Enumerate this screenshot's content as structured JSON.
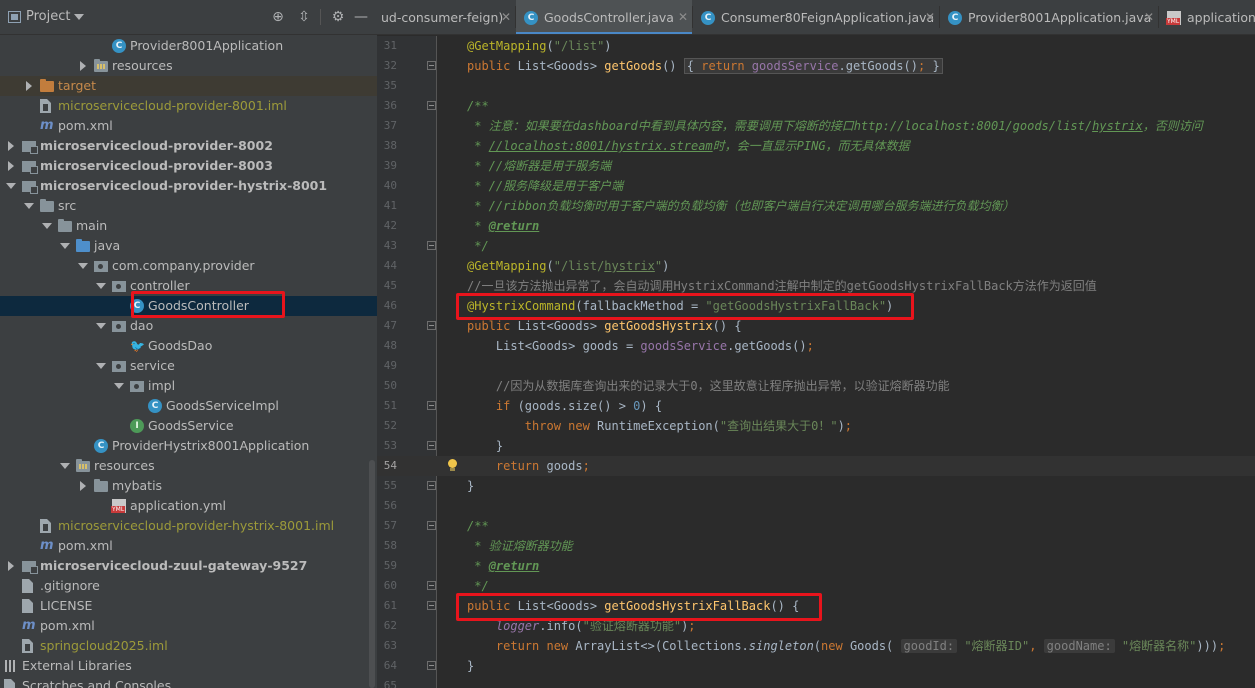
{
  "project": {
    "title": "Project"
  },
  "tree": [
    {
      "label": "Provider8001Application",
      "icon": "class-icon",
      "arrow": "",
      "bold": false,
      "color": ""
    },
    {
      "label": "resources",
      "icon": "resources-folder-icon",
      "arrow": "right",
      "bold": false,
      "color": ""
    },
    {
      "label": "target",
      "icon": "folder-orange-icon",
      "arrow": "right",
      "bold": false,
      "color": "orange"
    },
    {
      "label": "microservicecloud-provider-8001.iml",
      "icon": "iml-file-icon",
      "arrow": "",
      "bold": false,
      "color": "olive"
    },
    {
      "label": "pom.xml",
      "icon": "maven-icon",
      "arrow": "",
      "bold": false,
      "color": ""
    },
    {
      "label": "microservicecloud-provider-8002",
      "icon": "module-folder-icon",
      "arrow": "right",
      "bold": true,
      "color": ""
    },
    {
      "label": "microservicecloud-provider-8003",
      "icon": "module-folder-icon",
      "arrow": "right",
      "bold": true,
      "color": ""
    },
    {
      "label": "microservicecloud-provider-hystrix-8001",
      "icon": "module-folder-icon",
      "arrow": "down",
      "bold": true,
      "color": ""
    },
    {
      "label": "src",
      "icon": "folder-icon",
      "arrow": "down",
      "bold": false,
      "color": ""
    },
    {
      "label": "main",
      "icon": "folder-icon",
      "arrow": "down",
      "bold": false,
      "color": ""
    },
    {
      "label": "java",
      "icon": "folder-blue-icon",
      "arrow": "down",
      "bold": false,
      "color": ""
    },
    {
      "label": "com.company.provider",
      "icon": "package-icon",
      "arrow": "down",
      "bold": false,
      "color": ""
    },
    {
      "label": "controller",
      "icon": "package-icon",
      "arrow": "down",
      "bold": false,
      "color": ""
    },
    {
      "label": "GoodsController",
      "icon": "class-icon",
      "arrow": "",
      "bold": false,
      "color": ""
    },
    {
      "label": "dao",
      "icon": "package-icon",
      "arrow": "down",
      "bold": false,
      "color": ""
    },
    {
      "label": "GoodsDao",
      "icon": "mybatis-icon",
      "arrow": "",
      "bold": false,
      "color": ""
    },
    {
      "label": "service",
      "icon": "package-icon",
      "arrow": "down",
      "bold": false,
      "color": ""
    },
    {
      "label": "impl",
      "icon": "package-icon",
      "arrow": "down",
      "bold": false,
      "color": ""
    },
    {
      "label": "GoodsServiceImpl",
      "icon": "class-icon",
      "arrow": "",
      "bold": false,
      "color": ""
    },
    {
      "label": "GoodsService",
      "icon": "interface-icon",
      "arrow": "",
      "bold": false,
      "color": ""
    },
    {
      "label": "ProviderHystrix8001Application",
      "icon": "class-icon",
      "arrow": "",
      "bold": false,
      "color": ""
    },
    {
      "label": "resources",
      "icon": "resources-folder-icon",
      "arrow": "down",
      "bold": false,
      "color": ""
    },
    {
      "label": "mybatis",
      "icon": "folder-icon",
      "arrow": "right",
      "bold": false,
      "color": ""
    },
    {
      "label": "application.yml",
      "icon": "yml-file-icon",
      "arrow": "",
      "bold": false,
      "color": ""
    },
    {
      "label": "microservicecloud-provider-hystrix-8001.iml",
      "icon": "iml-file-icon",
      "arrow": "",
      "bold": false,
      "color": "olive"
    },
    {
      "label": "pom.xml",
      "icon": "maven-icon",
      "arrow": "",
      "bold": false,
      "color": ""
    },
    {
      "label": "microservicecloud-zuul-gateway-9527",
      "icon": "module-folder-icon",
      "arrow": "right",
      "bold": true,
      "color": ""
    },
    {
      "label": ".gitignore",
      "icon": "text-file-icon",
      "arrow": "",
      "bold": false,
      "color": ""
    },
    {
      "label": "LICENSE",
      "icon": "text-file-icon",
      "arrow": "",
      "bold": false,
      "color": ""
    },
    {
      "label": "pom.xml",
      "icon": "maven-icon",
      "arrow": "",
      "bold": false,
      "color": ""
    },
    {
      "label": "springcloud2025.iml",
      "icon": "iml-file-icon",
      "arrow": "",
      "bold": false,
      "color": "olive"
    },
    {
      "label": "External Libraries",
      "icon": "libraries-icon",
      "arrow": "right",
      "bold": false,
      "color": ""
    },
    {
      "label": "Scratches and Consoles",
      "icon": "scratches-icon",
      "arrow": "",
      "bold": false,
      "color": ""
    }
  ],
  "tabs": [
    {
      "label": "ud-consumer-feign)",
      "icon": "",
      "active": false
    },
    {
      "label": "GoodsController.java",
      "icon": "class-icon",
      "active": true
    },
    {
      "label": "Consumer80FeignApplication.java",
      "icon": "class-icon",
      "active": false
    },
    {
      "label": "Provider8001Application.java",
      "icon": "class-icon",
      "active": false
    },
    {
      "label": "application.y",
      "icon": "yml-file-icon",
      "active": false
    }
  ],
  "editor": {
    "current_line": "54",
    "lines": [
      {
        "n": "31",
        "html": "<span class='an'>@GetMapping</span><span class='id'>(</span><span class='str'>\"/list\"</span><span class='id'>)</span>"
      },
      {
        "n": "32",
        "html": "<span class='kw'>public </span><span class='id'>List&lt;Goods&gt; </span><span class='mcall'>getGoods</span><span class='id'>() </span><span class='folded'><span class='id'>{ </span><span class='kw'>return </span><span class='fld' style='font-style:normal'>goodsService</span><span class='id'>.getGoods()</span><span class='kw'>; </span><span class='id'>}</span></span>"
      },
      {
        "n": "35",
        "html": ""
      },
      {
        "n": "36",
        "html": "<span class='doc'>/**</span>"
      },
      {
        "n": "37",
        "html": "<span class='doc'> * 注意：如果要在dashboard中看到具体内容，需要调用下熔断的接口http://localhost:8001/goods/list/<u>hystrix</u>，否则访问</span>"
      },
      {
        "n": "38",
        "html": "<span class='doc'> * <u>//localhost:8001/hystrix.stream</u>时，会一直显示PING，而无具体数据</span>"
      },
      {
        "n": "39",
        "html": "<span class='doc'> * //熔断器是用于服务端</span>"
      },
      {
        "n": "40",
        "html": "<span class='doc'> * //服务降级是用于客户端</span>"
      },
      {
        "n": "41",
        "html": "<span class='doc'> * //ribbon负载均衡时用于客户端的负载均衡（也即客户端自行决定调用哪台服务端进行负载均衡）</span>"
      },
      {
        "n": "42",
        "html": "<span class='doc'> * </span><span class='doctag'>@return</span>"
      },
      {
        "n": "43",
        "html": "<span class='doc'> */</span>"
      },
      {
        "n": "44",
        "html": "<span class='an'>@GetMapping</span><span class='id'>(</span><span class='str'>\"/list/<u>hystrix</u>\"</span><span class='id'>)</span>"
      },
      {
        "n": "45",
        "html": "<span class='cm'>//一旦该方法抛出异常了，会自动调用HystrixCommand注解中制定的getGoodsHystrixFallBack方法作为返回值</span>"
      },
      {
        "n": "46",
        "html": "<span class='an'>@HystrixCommand</span><span class='id'>(fallbackMethod = </span><span class='str'>\"getGoodsHystrixFallBack\"</span><span class='id'>)</span>"
      },
      {
        "n": "47",
        "html": "<span class='kw'>public </span><span class='id'>List&lt;Goods&gt; </span><span class='mcall'>getGoodsHystrix</span><span class='id'>() {</span>"
      },
      {
        "n": "48",
        "html": "<span class='id'>    List&lt;Goods&gt; goods = </span><span class='fld' style='font-style:normal'>goodsService</span><span class='id'>.getGoods()</span><span class='kw'>;</span>"
      },
      {
        "n": "49",
        "html": ""
      },
      {
        "n": "50",
        "html": "<span class='cm'>    //因为从数据库查询出来的记录大于0，这里故意让程序抛出异常，以验证熔断器功能</span>"
      },
      {
        "n": "51",
        "html": "<span class='kw'>    if </span><span class='id'>(goods.size() &gt; </span><span class='num'>0</span><span class='id'>) {</span>"
      },
      {
        "n": "52",
        "html": "<span class='kw'>        throw new </span><span class='id'>RuntimeException(</span><span class='str'>\"查询出结果大于0！\"</span><span class='id'>)</span><span class='kw'>;</span>"
      },
      {
        "n": "53",
        "html": "<span class='id'>    }</span>"
      },
      {
        "n": "54",
        "html": "<span class='kw'>    return </span><span class='id'>goods</span><span class='kw'>;</span>"
      },
      {
        "n": "55",
        "html": "<span class='id'>}</span>"
      },
      {
        "n": "56",
        "html": ""
      },
      {
        "n": "57",
        "html": "<span class='doc'>/**</span>"
      },
      {
        "n": "58",
        "html": "<span class='doc'> * 验证熔断器功能</span>"
      },
      {
        "n": "59",
        "html": "<span class='doc'> * </span><span class='doctag'>@return</span>"
      },
      {
        "n": "60",
        "html": "<span class='doc'> */</span>"
      },
      {
        "n": "61",
        "html": "<span class='kw'>public </span><span class='id'>List&lt;Goods&gt; </span><span class='mcall'>getGoodsHystrixFallBack</span><span class='id'>() {</span>"
      },
      {
        "n": "62",
        "html": "<span class='fld'>    logger</span><span class='id'>.info(</span><span class='str'>\"验证熔断器功能\"</span><span class='id'>)</span><span class='kw'>;</span>"
      },
      {
        "n": "63",
        "html": "<span class='kw'>    return new </span><span class='id'>ArrayList&lt;&gt;(Collections.</span><span class='it id'>singleton</span><span class='id'>(</span><span class='kw'>new </span><span class='id'>Goods( </span><span class='hint'>goodId:</span><span class='str'> \"熔断器ID\"</span><span class='kw'>, </span><span class='hint'>goodName:</span><span class='str'> \"熔断器名称\"</span><span class='id'>)))</span><span class='kw'>;</span>"
      },
      {
        "n": "64",
        "html": "<span class='id'>}</span>"
      },
      {
        "n": "65",
        "html": ""
      }
    ]
  },
  "colors": {
    "highlight_box": "#e8141c",
    "selection": "#0d293e"
  }
}
